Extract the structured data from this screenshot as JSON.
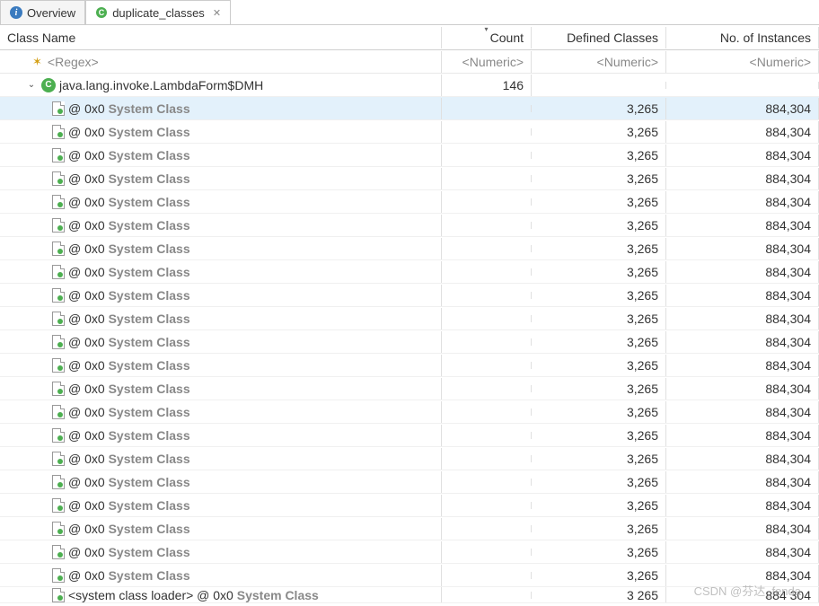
{
  "tabs": [
    {
      "label": "Overview",
      "icon": "info"
    },
    {
      "label": "duplicate_classes",
      "icon": "class",
      "active": true,
      "closable": true
    }
  ],
  "headers": {
    "name": "Class Name",
    "count": "Count",
    "defined": "Defined Classes",
    "instances": "No. of Instances"
  },
  "filter": {
    "regex": "<Regex>",
    "numeric": "<Numeric>"
  },
  "parent_row": {
    "name": "java.lang.invoke.LambdaForm$DMH",
    "count": "146"
  },
  "child_row": {
    "loader_text": "<system class loader> @ 0x0",
    "badge_text": "System Class",
    "defined": "3,265",
    "instances": "884,304"
  },
  "partial_row": {
    "defined": "3 265",
    "instances": "884 304"
  },
  "row_count": 21,
  "watermark": "CSDN @芬达_fenda"
}
